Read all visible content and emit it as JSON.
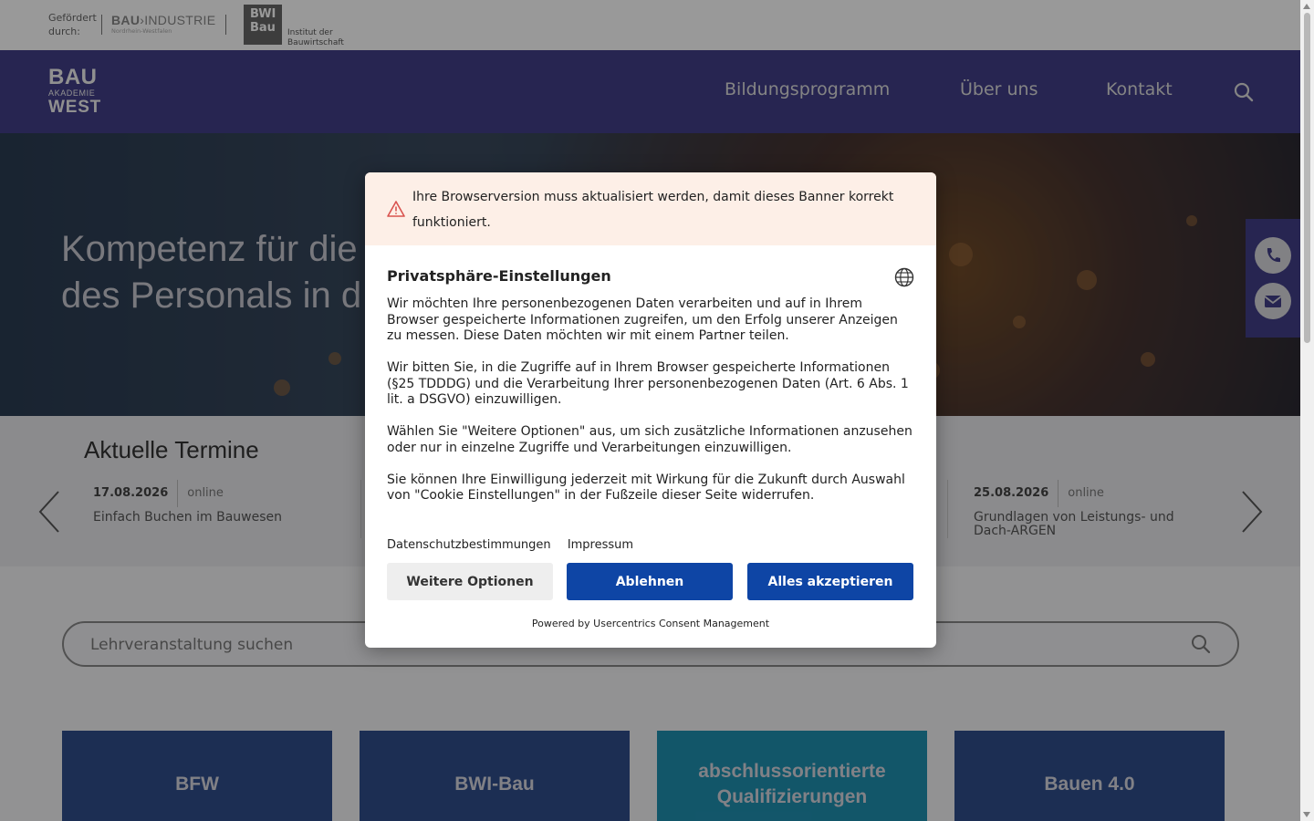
{
  "topbar": {
    "funded_by": "Gefördert\ndurch:",
    "bau_industrie_bold": "BAU",
    "bau_industrie_rest": "INDUSTRIE",
    "bau_industrie_sub": "Nordrhein-Westfalen",
    "bwi_logo": "BWI\nBau",
    "bwi_caption": "Institut der\nBauwirtschaft"
  },
  "header": {
    "logo_line1": "BAU",
    "logo_line2": "AKADEMIE",
    "logo_line3": "WEST",
    "nav": [
      "Bildungsprogramm",
      "Über uns",
      "Kontakt"
    ],
    "bg_color": "#413e87"
  },
  "hero": {
    "headline_line1": "Kompetenz für die",
    "headline_line2": "des Personals in d"
  },
  "termine": {
    "heading": "Aktuelle Termine",
    "events": [
      {
        "date": "17.08.2026",
        "mode": "online",
        "title": "Einfach Buchen im Bauwesen"
      },
      {
        "date": "25.08.2026",
        "mode": "online",
        "title": "Grundlagen von Leistungs- und Dach-ARGEN"
      }
    ]
  },
  "search": {
    "placeholder": "Lehrveranstaltung suchen"
  },
  "tiles": [
    {
      "label": "BFW",
      "color": "#2f4d8a"
    },
    {
      "label": "BWI-Bau",
      "color": "#2f4d8a"
    },
    {
      "label": "abschlussorientierte Qualifizierungen",
      "color": "#1f8fb0"
    },
    {
      "label": "Bauen 4.0",
      "color": "#2f4d8a"
    }
  ],
  "consent": {
    "warning": "Ihre Browserversion muss aktualisiert werden, damit dieses Banner korrekt funktioniert.",
    "title": "Privatsphäre-Einstellungen",
    "paragraphs": [
      "Wir möchten Ihre personenbezogenen Daten verarbeiten und auf in Ihrem Browser gespeicherte Informationen zugreifen, um den Erfolg unserer Anzeigen zu messen. Diese Daten möchten wir mit einem Partner teilen.",
      "Wir bitten Sie, in die Zugriffe auf in Ihrem Browser gespeicherte Informationen (§25 TDDDG) und die Verarbeitung Ihrer personenbezogenen Daten (Art. 6 Abs. 1 lit. a DSGVO) einzuwilligen.",
      "Wählen Sie \"Weitere Optionen\" aus, um sich zusätzliche Informationen anzusehen oder nur in einzelne Zugriffe und Verarbeitungen einzuwilligen.",
      "Sie können Ihre Einwilligung jederzeit mit Wirkung für die Zukunft durch Auswahl von \"Cookie Einstellungen\" in der Fußzeile dieser Seite widerrufen."
    ],
    "link_privacy": "Datenschutzbestimmungen",
    "link_imprint": "Impressum",
    "btn_more": "Weitere Optionen",
    "btn_deny": "Ablehnen",
    "btn_accept": "Alles akzeptieren",
    "powered_by": "Powered by Usercentrics Consent Management",
    "accent_color": "#0e45a5"
  },
  "icons": {
    "nav_search": "search-icon",
    "phone": "phone-icon",
    "mail": "mail-icon",
    "warning": "warning-icon",
    "language": "globe-icon",
    "prev": "chevron-left-icon",
    "next": "chevron-right-icon"
  }
}
